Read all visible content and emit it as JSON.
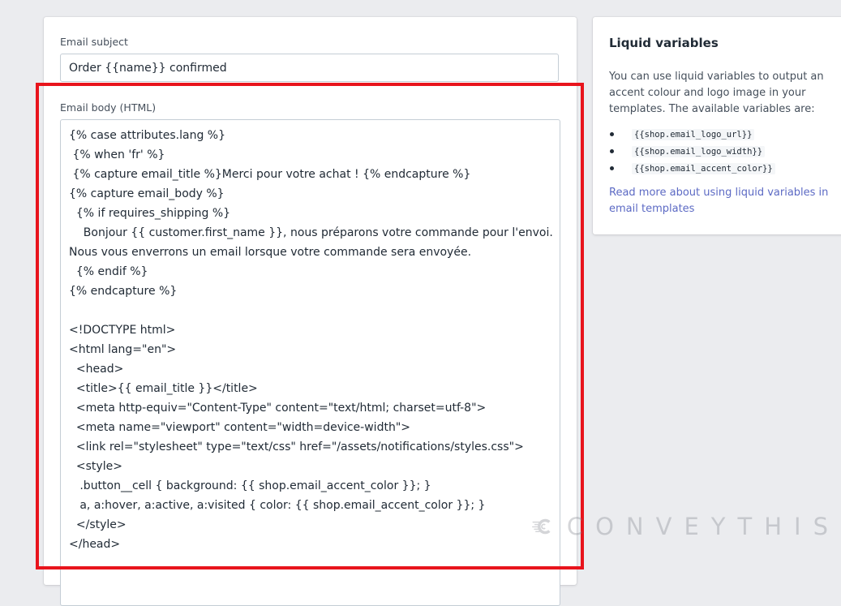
{
  "subject": {
    "label": "Email subject",
    "value": "Order {{name}} confirmed"
  },
  "body": {
    "label": "Email body (HTML)",
    "lines": [
      "{% case attributes.lang %}",
      " {% when 'fr' %}",
      " {% capture email_title %}Merci pour votre achat ! {% endcapture %}",
      "{% capture email_body %}",
      "  {% if requires_shipping %}",
      "    Bonjour {{ customer.first_name }}, nous préparons votre commande pour l'envoi.",
      "Nous vous enverrons un email lorsque votre commande sera envoyée.",
      "  {% endif %}",
      "{% endcapture %}",
      "",
      "<!DOCTYPE html>",
      "<html lang=\"en\">",
      "  <head>",
      "  <title>{{ email_title }}</title>",
      "  <meta http-equiv=\"Content-Type\" content=\"text/html; charset=utf-8\">",
      "  <meta name=\"viewport\" content=\"width=device-width\">",
      "  <link rel=\"stylesheet\" type=\"text/css\" href=\"/assets/notifications/styles.css\">",
      "  <style>",
      "   .button__cell { background: {{ shop.email_accent_color }}; }",
      "   a, a:hover, a:active, a:visited { color: {{ shop.email_accent_color }}; }",
      "  </style>",
      "</head>"
    ]
  },
  "sidebar": {
    "title": "Liquid variables",
    "description": "You can use liquid variables to output an accent colour and logo image in your templates. The available variables are:",
    "variables": [
      "{{shop.email_logo_url}}",
      "{{shop.email_logo_width}}",
      "{{shop.email_accent_color}}"
    ],
    "link": "Read more about using liquid variables in email templates"
  },
  "watermark": {
    "brand": "CONVEYTHIS"
  },
  "colors": {
    "highlight": "#e8141c",
    "link": "#5c6ac4",
    "background": "#ebecef"
  }
}
